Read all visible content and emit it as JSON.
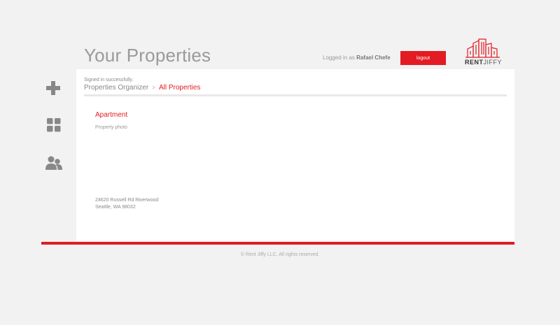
{
  "header": {
    "title": "Your Properties",
    "logged_in_prefix": "Logged in as",
    "user_name": "Rafael Chefe",
    "logout_label": "logout",
    "logo_text_bold": "RENT",
    "logo_text_light": "JIFFY"
  },
  "sidebar": {
    "items": [
      {
        "icon": "plus-icon"
      },
      {
        "icon": "grid-icon"
      },
      {
        "icon": "users-icon"
      }
    ]
  },
  "main": {
    "flash_message": "Signed in successfully.",
    "breadcrumb": {
      "root": "Properties Organizer",
      "separator": ">",
      "current": "All Properties"
    },
    "property": {
      "type": "Apartment",
      "photo_label": "Property photo",
      "address_line1": "24620 Russell Rd Riverwood",
      "address_line2": "Seattle, WA 98032"
    }
  },
  "footer": {
    "copyright": "© Rent Jiffy LLC. All rights reserved."
  },
  "colors": {
    "accent": "#e31b23",
    "background": "#f2f2f2",
    "panel": "#ffffff"
  }
}
